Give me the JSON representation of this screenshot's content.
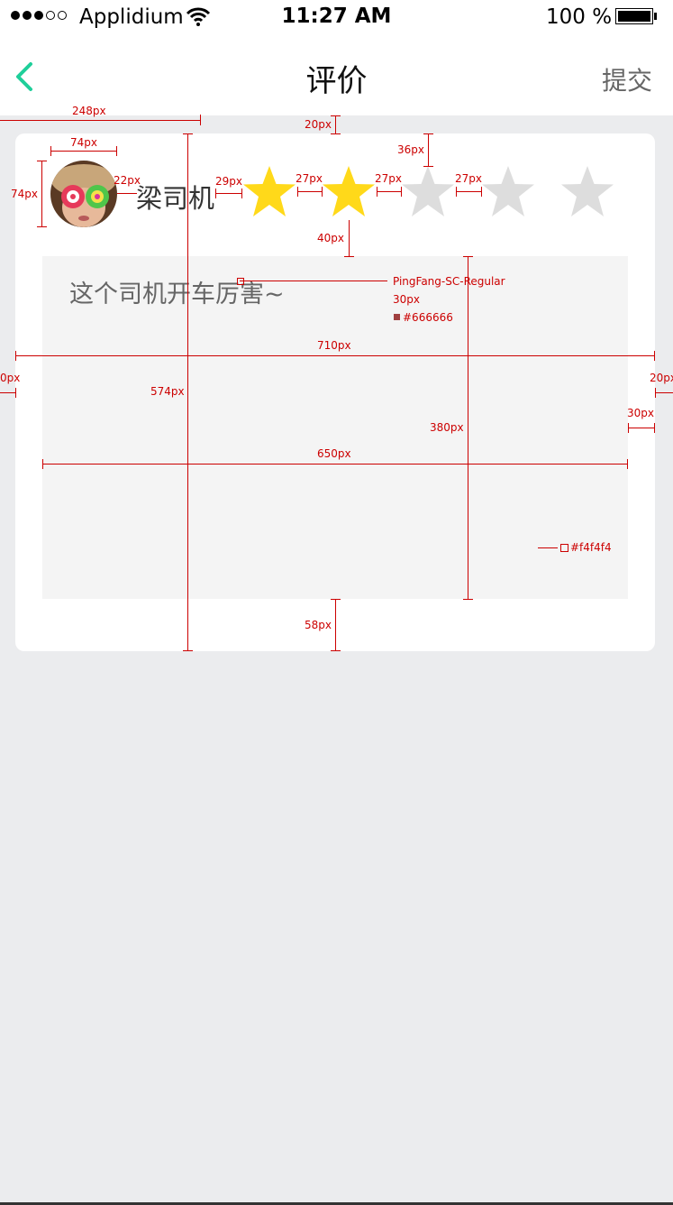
{
  "status_bar": {
    "carrier": "Applidium",
    "time": "11:27 AM",
    "battery": "100 %"
  },
  "nav": {
    "title": "评价",
    "submit": "提交"
  },
  "driver": {
    "name": "梁司机"
  },
  "rating": {
    "value": 2,
    "max": 5,
    "filled_color": "#FFD91A",
    "empty_color": "#DDDDDD"
  },
  "comment": {
    "placeholder": "这个司机开车厉害~",
    "bg": "#f4f4f4",
    "text_color": "#666666"
  },
  "annotations": {
    "a248": "248px",
    "a20": "20px",
    "a74w": "74px",
    "a74h": "74px",
    "a22": "22px",
    "a29": "29px",
    "a27_1": "27px",
    "a27_2": "27px",
    "a27_3": "27px",
    "a36": "36px",
    "a40": "40px",
    "font": "PingFang-SC-Regular",
    "fsize": "30px",
    "color1": "#666666",
    "a710": "710px",
    "a20l": "0px",
    "a20r": "20px",
    "a574": "574px",
    "a380": "380px",
    "a30": "30px",
    "a650": "650px",
    "color2": "#f4f4f4",
    "a58": "58px"
  }
}
